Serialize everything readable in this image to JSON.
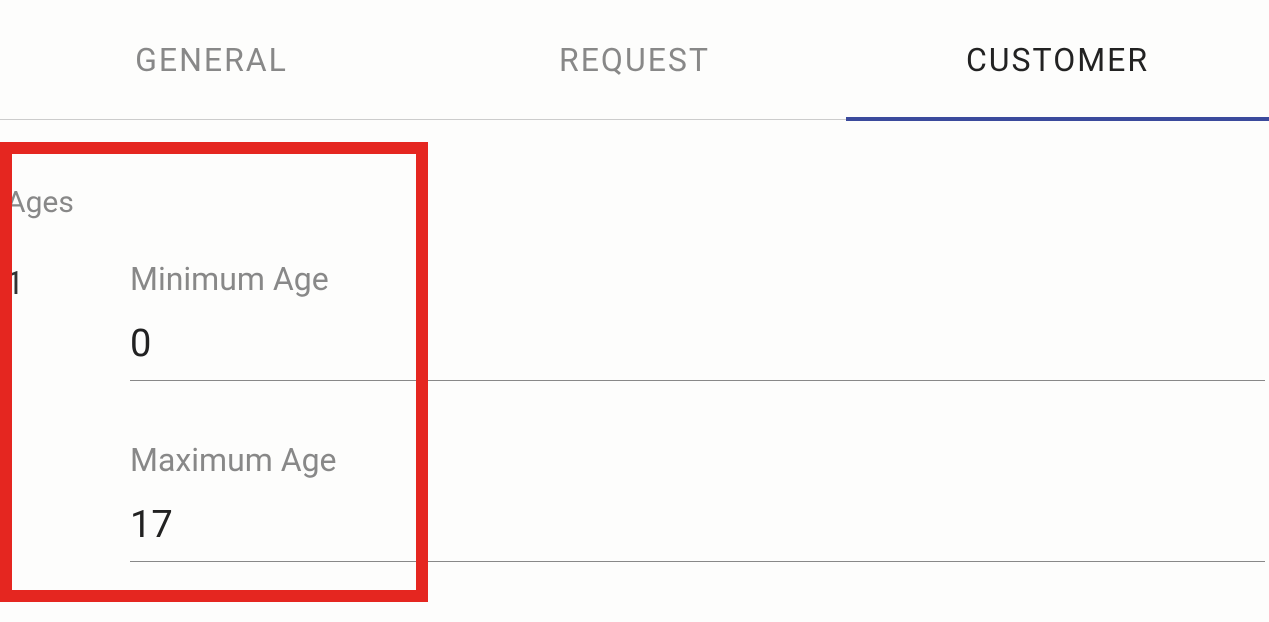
{
  "tabs": {
    "general": "GENERAL",
    "request": "REQUEST",
    "customer": "CUSTOMER",
    "active": "customer"
  },
  "section": {
    "title": "Ages",
    "rows": [
      {
        "index": "1",
        "min_label": "Minimum Age",
        "min_value": "0",
        "max_label": "Maximum Age",
        "max_value": "17"
      }
    ]
  }
}
